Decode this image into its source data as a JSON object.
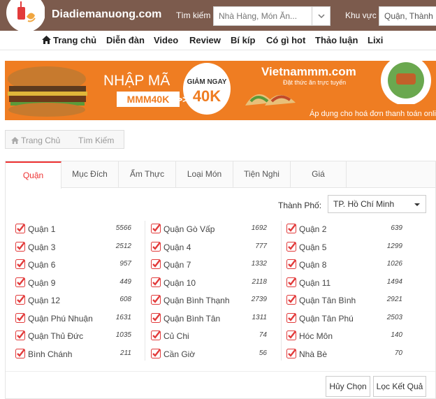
{
  "header": {
    "brand": "Diadiemanuong.com",
    "search_label": "Tìm kiếm",
    "search_placeholder": "Nhà Hàng, Món Ăn...",
    "area_label": "Khu vực",
    "area_value": "Quận, Thành P"
  },
  "nav": {
    "items": [
      {
        "label": "Trang chủ",
        "icon": "home-icon"
      },
      {
        "label": "Diễn đàn"
      },
      {
        "label": "Video"
      },
      {
        "label": "Review"
      },
      {
        "label": "Bí kíp"
      },
      {
        "label": "Có gì hot"
      },
      {
        "label": "Thảo luận"
      },
      {
        "label": "Lixi"
      }
    ]
  },
  "banner": {
    "headline": "NHẬP MÃ",
    "code": "MMM40K",
    "arrow": ">>",
    "discount_label": "GIẢM NGAY",
    "discount_value": "40K",
    "partner": "Vietnammm.com",
    "partner_tagline": "Đặt thức ăn trực tuyến",
    "apply_note": "Áp dụng cho hoá đơn thanh toán online",
    "accent": "#ef7d22"
  },
  "breadcrumb": {
    "home": "Trang Chủ",
    "current": "Tìm Kiếm"
  },
  "filter": {
    "tabs": [
      {
        "label": "Quận",
        "active": true
      },
      {
        "label": "Mục Đích",
        "active": false
      },
      {
        "label": "Ẩm Thực",
        "active": false
      },
      {
        "label": "Loại Món",
        "active": false
      },
      {
        "label": "Tiện Nghi",
        "active": false
      },
      {
        "label": "Giá",
        "active": false
      }
    ],
    "city_label": "Thành Phố:",
    "city_value": "TP. Hồ Chí Minh",
    "columns": [
      [
        {
          "name": "Quận 1",
          "count": "5566"
        },
        {
          "name": "Quận 3",
          "count": "2512"
        },
        {
          "name": "Quận 6",
          "count": "957"
        },
        {
          "name": "Quận 9",
          "count": "449"
        },
        {
          "name": "Quận 12",
          "count": "608"
        },
        {
          "name": "Quận Phú Nhuận",
          "count": "1631"
        },
        {
          "name": "Quận Thủ Đức",
          "count": "1035"
        },
        {
          "name": "Bình Chánh",
          "count": "211"
        }
      ],
      [
        {
          "name": "Quận Gò Vấp",
          "count": "1692"
        },
        {
          "name": "Quận 4",
          "count": "777"
        },
        {
          "name": "Quận 7",
          "count": "1332"
        },
        {
          "name": "Quận 10",
          "count": "2118"
        },
        {
          "name": "Quận Bình Thạnh",
          "count": "2739"
        },
        {
          "name": "Quận Bình Tân",
          "count": "1311"
        },
        {
          "name": "Củ Chi",
          "count": "74"
        },
        {
          "name": "Cần Giờ",
          "count": "56"
        }
      ],
      [
        {
          "name": "Quận 2",
          "count": "639"
        },
        {
          "name": "Quận 5",
          "count": "1299"
        },
        {
          "name": "Quận 8",
          "count": "1026"
        },
        {
          "name": "Quận 11",
          "count": "1494"
        },
        {
          "name": "Quận Tân Bình",
          "count": "2921"
        },
        {
          "name": "Quận Tân Phú",
          "count": "2503"
        },
        {
          "name": "Hóc Môn",
          "count": "140"
        },
        {
          "name": "Nhà Bè",
          "count": "70"
        }
      ]
    ],
    "cancel_label": "Hủy Chọn",
    "apply_label": "Lọc Kết Quả",
    "checkbox_color": "#e23b3b"
  },
  "colors": {
    "header_bg": "#7c5b4d",
    "active_tab": "#e33333"
  }
}
